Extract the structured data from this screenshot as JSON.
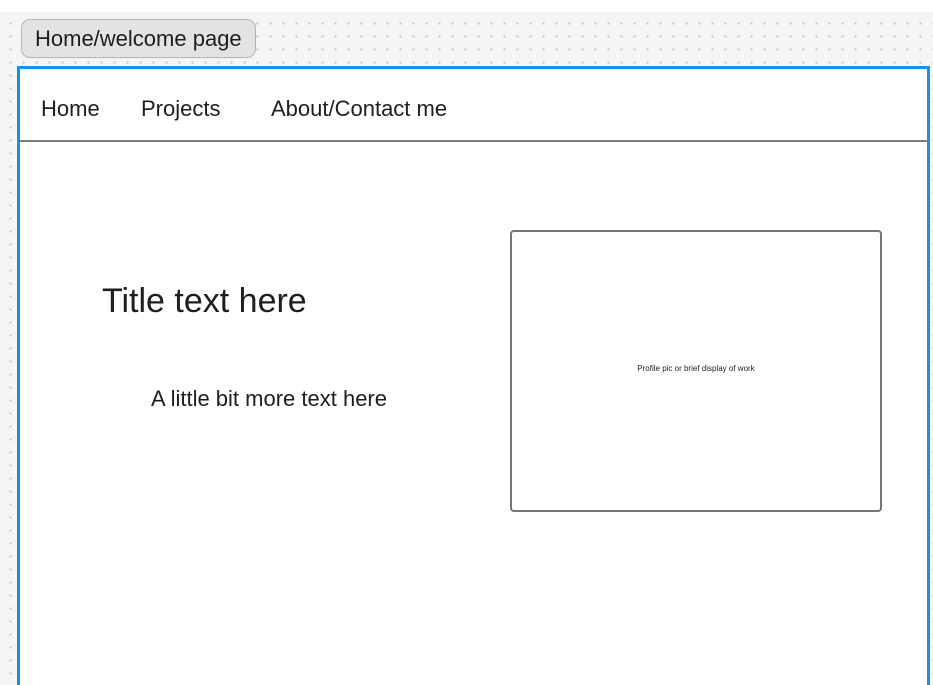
{
  "canvas": {
    "background": "#f5f5f5",
    "dot_color": "#c4c4c4",
    "frame_label": "Home/welcome page",
    "frame_selection_color": "#1e8fe6"
  },
  "navbar": {
    "items": [
      {
        "label": "Home"
      },
      {
        "label": "Projects"
      },
      {
        "label": "About/Contact me"
      }
    ],
    "divider_color": "#7a7a7a"
  },
  "hero": {
    "title": "Title text here",
    "subtext": "A little bit more text here"
  },
  "placeholder": {
    "caption": "Profile pic or brief display of work",
    "border_color": "#757575"
  },
  "text_color": "#1e1e1e"
}
